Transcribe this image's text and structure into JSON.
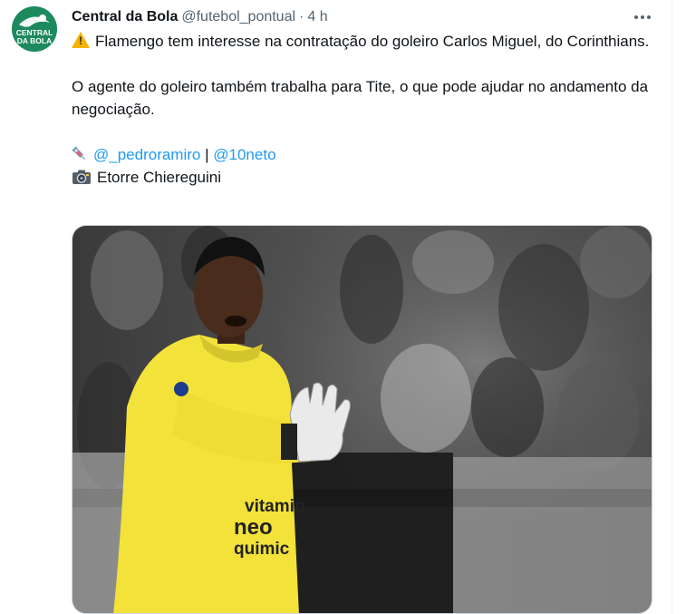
{
  "tweet": {
    "author": {
      "display_name": "Central da Bola",
      "handle": "@futebol_pontual",
      "separator": "·",
      "timestamp": "4 h",
      "avatar_text_top": "CENTRAL",
      "avatar_text_bottom": "DA BOLA"
    },
    "text": {
      "line1": "Flamengo tem interesse na contratação do goleiro Carlos Miguel, do Corinthians.",
      "line2": "O agente do goleiro também trabalha para Tite, o que pode ajudar no andamento da negociação.",
      "mention1": "@_pedroramiro",
      "mention_sep": "|",
      "mention2": "@10neto",
      "photo_credit": "Etorre Chiereguini"
    },
    "icons": {
      "warning": "warning-icon",
      "syringe": "syringe-icon",
      "camera": "camera-icon",
      "more": "more-icon"
    },
    "media": {
      "jersey_text_1": "vitamin",
      "jersey_text_2": "neo",
      "jersey_text_3": "quimic"
    }
  },
  "colors": {
    "link": "#1d9bf0",
    "secondary_text": "#536471",
    "avatar_bg": "#1d8a5e",
    "jersey": "#f2e23a"
  }
}
